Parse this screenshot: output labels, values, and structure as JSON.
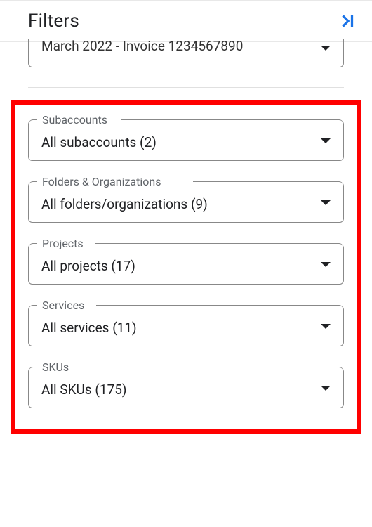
{
  "header": {
    "title": "Filters"
  },
  "invoice": {
    "text": "March 2022 - Invoice 1234567890"
  },
  "filters": {
    "subaccounts": {
      "label": "Subaccounts",
      "value": "All subaccounts (2)"
    },
    "folders": {
      "label": "Folders & Organizations",
      "value": "All folders/organizations (9)"
    },
    "projects": {
      "label": "Projects",
      "value": "All projects (17)"
    },
    "services": {
      "label": "Services",
      "value": "All services (11)"
    },
    "skus": {
      "label": "SKUs",
      "value": "All SKUs (175)"
    }
  }
}
